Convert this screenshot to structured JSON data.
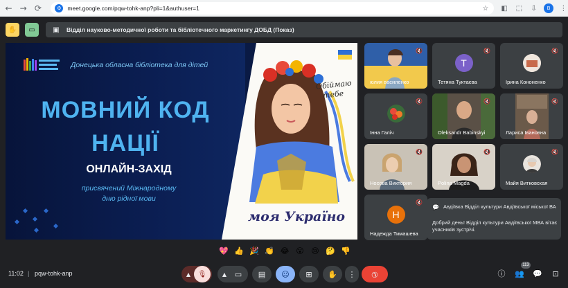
{
  "browser": {
    "url": "meet.google.com/pqw-tohk-anp?pli=1&authuser=1",
    "profile_initial": "B",
    "icons": [
      "back-arrow-icon",
      "forward-arrow-icon",
      "reload-icon",
      "site-info-icon",
      "bookmark-star-icon",
      "extension-icon",
      "puzzle-icon",
      "downloads-icon"
    ]
  },
  "meet": {
    "presentation_title": "Відділ науково-методичної роботи та бібліотечного маркетингу ДОБД (Показ)"
  },
  "slide": {
    "org": "Донецька обласна бібліотека для дітей",
    "title_line1": "МОВНИЙ КОД",
    "title_line2": "НАЦІЇ",
    "subtitle": "ОНЛАЙН-ЗАХІД",
    "desc_line1": "присвячений  Міжнародному",
    "desc_line2": "дню рідної мови",
    "script_line1": "Обіймаю",
    "script_line2": "тебе",
    "script_bottom": "моя Україно",
    "colors": {
      "bg": "#0b1e52",
      "title": "#4fb3f0",
      "desc": "#5ab9f2"
    }
  },
  "participants": [
    {
      "name": "юлия василенко",
      "kind": "photo",
      "muted": true
    },
    {
      "name": "Тетяна Туктаєва",
      "kind": "avatar",
      "initial": "T",
      "color": "#7b61c9",
      "muted": true
    },
    {
      "name": "Ірина Кононенко",
      "kind": "photo-avatar",
      "muted": true
    },
    {
      "name": "Інна Галіч",
      "kind": "photo-avatar",
      "muted": true
    },
    {
      "name": "Oleksandr Babinskyi",
      "kind": "photo",
      "muted": true
    },
    {
      "name": "Лариса Іванoвна",
      "kind": "photo",
      "muted": true
    },
    {
      "name": "Носова Виктория",
      "kind": "photo",
      "muted": true
    },
    {
      "name": "Polina Magda",
      "kind": "photo",
      "muted": true
    },
    {
      "name": "Майя Витковская",
      "kind": "photo-avatar",
      "muted": true
    },
    {
      "name": "Надежда Тимашева",
      "kind": "avatar",
      "initial": "Н",
      "color": "#e8710a",
      "muted": true
    }
  ],
  "chat_toast": {
    "sender": "Авдіївка Відділ культури Авдіївської міської ВА",
    "message": "Добрий день! Відділ культури Авдіївської МВА вітає учасників зустрічі."
  },
  "reactions": [
    "💖",
    "👍",
    "🎉",
    "👏",
    "😂",
    "😮",
    "😢",
    "🤔",
    "👎"
  ],
  "bottom": {
    "time": "11:02",
    "separator": "|",
    "meeting_code": "pqw-tohk-anp",
    "participant_count": "113",
    "end_call_color": "#ea4335"
  }
}
